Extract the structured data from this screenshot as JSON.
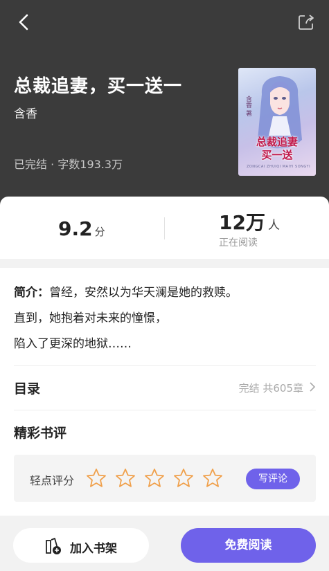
{
  "book": {
    "title": "总裁追妻，买一送一",
    "author": "含香",
    "status": "已完结 · 字数193.3万"
  },
  "cover": {
    "title_line1": "总裁追妻",
    "title_line2": "买一送",
    "author_tag": "含香 著",
    "small_text": "ZONGCAI ZHUIQI MAIYI SONGYI"
  },
  "stats": {
    "rating_value": "9.2",
    "rating_unit": "分",
    "readers_value": "12万",
    "readers_unit": "人",
    "readers_label": "正在阅读"
  },
  "intro": {
    "label": "简介",
    "colon": "：",
    "line1": "曾经，安然以为华天澜是她的救赎。",
    "line2": "直到，她抱着对未来的憧憬，",
    "line3": "陷入了更深的地狱……"
  },
  "toc": {
    "title": "目录",
    "summary": "完结 共605章"
  },
  "reviews": {
    "title": "精彩书评",
    "rate_label": "轻点评分",
    "star_count": 5,
    "write_label": "写评论"
  },
  "actions": {
    "add_shelf_label": "加入书架",
    "read_free_label": "免费阅读"
  },
  "colors": {
    "accent": "#6f62ea",
    "header_bg": "#3b3b3b",
    "star_outline": "#f0a04b"
  },
  "icons": {
    "back": "chevron-left-icon",
    "share": "share-icon",
    "toc_arrow": "chevron-right-icon",
    "star": "star-outline-icon",
    "shelf": "add-bookshelf-icon"
  }
}
